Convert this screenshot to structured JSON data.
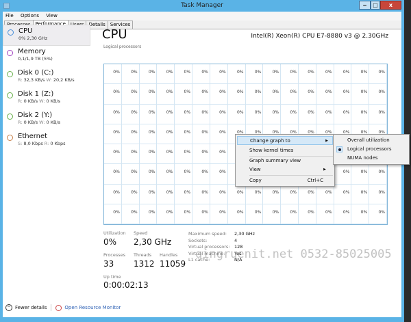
{
  "window": {
    "title": "Task Manager",
    "minimize": "‒",
    "maximize": "□",
    "close": "x"
  },
  "menu": [
    "File",
    "Options",
    "View"
  ],
  "tabs": [
    "Processes",
    "Performance",
    "Users",
    "Details",
    "Services"
  ],
  "active_tab": "Performance",
  "sidebar": [
    {
      "name": "CPU",
      "sub": "0% 2,30 GHz",
      "color": "#4a90d9",
      "selected": true
    },
    {
      "name": "Memory",
      "sub": "0,1/1,9 TB (5%)",
      "color": "#a040c0"
    },
    {
      "name": "Disk 0 (C:)",
      "sub_k1": "R:",
      "sub_v1": "32,3 KB/s",
      "sub_k2": "W:",
      "sub_v2": "20,2 KB/s",
      "color": "#6ab04c"
    },
    {
      "name": "Disk 1 (Z:)",
      "sub_k1": "R:",
      "sub_v1": "0 KB/s",
      "sub_k2": "W:",
      "sub_v2": "0 KB/s",
      "color": "#6ab04c"
    },
    {
      "name": "Disk 2 (Y:)",
      "sub_k1": "R:",
      "sub_v1": "0 KB/s",
      "sub_k2": "W:",
      "sub_v2": "0 KB/s",
      "color": "#6ab04c"
    },
    {
      "name": "Ethernet",
      "sub_k1": "S:",
      "sub_v1": "8,0 Kbps",
      "sub_k2": "R:",
      "sub_v2": "0 Kbps",
      "color": "#c8804a"
    }
  ],
  "main": {
    "title": "CPU",
    "cpu_name": "Intel(R) Xeon(R) CPU E7-8880 v3 @ 2.30GHz",
    "graph_label": "Logical processors",
    "processor_usage": [
      "0%",
      "0%",
      "0%",
      "0%",
      "0%",
      "0%",
      "0%",
      "0%",
      "0%",
      "0%",
      "0%",
      "0%",
      "0%",
      "0%",
      "0%",
      "0%",
      "0%",
      "0%",
      "0%",
      "0%",
      "0%",
      "0%",
      "0%",
      "0%",
      "0%",
      "0%",
      "0%",
      "0%",
      "0%",
      "0%",
      "0%",
      "0%",
      "0%",
      "0%",
      "0%",
      "0%",
      "0%",
      "0%",
      "0%",
      "0%",
      "0%",
      "0%",
      "0%",
      "0%",
      "0%",
      "0%",
      "0%",
      "0%",
      "0%",
      "0%",
      "0%",
      "0%",
      "0%",
      "0%",
      "0%",
      "0%",
      "0%",
      "0%",
      "0%",
      "0%",
      "0%",
      "0%",
      "0%",
      "0%",
      "0%",
      "0%",
      "0%",
      "0%",
      "0%",
      "0%",
      "0%",
      "0%",
      "0%",
      "0%",
      "0%",
      "0%",
      "0%",
      "0%",
      "0%",
      "0%",
      "0%",
      "0%",
      "0%",
      "0%",
      "0%",
      "0%",
      "0%",
      "0%",
      "0%",
      "0%",
      "0%",
      "0%",
      "0%",
      "0%",
      "0%",
      "0%",
      "0%",
      "0%",
      "0%",
      "0%",
      "0%",
      "0%",
      "0%",
      "0%",
      "0%",
      "0%",
      "0%",
      "0%",
      "0%",
      "0%",
      "0%",
      "0%",
      "0%",
      "0%",
      "0%",
      "0%",
      "0%",
      "0%",
      "0%",
      "0%",
      "0%",
      "0%",
      "0%",
      "0%",
      "0%",
      "0%",
      "0%",
      "0%"
    ]
  },
  "stats": {
    "utilization_label": "Utilization",
    "utilization": "0%",
    "speed_label": "Speed",
    "speed": "2,30 GHz",
    "processes_label": "Processes",
    "processes": "33",
    "threads_label": "Threads",
    "threads": "1312",
    "handles_label": "Handles",
    "handles": "11059",
    "uptime_label": "Up time",
    "uptime": "0:00:02:13",
    "details": [
      {
        "k": "Maximum speed:",
        "v": "2,30 GHz"
      },
      {
        "k": "Sockets:",
        "v": "4"
      },
      {
        "k": "Virtual processors:",
        "v": "128"
      },
      {
        "k": "Virtual machine:",
        "v": "Yes"
      },
      {
        "k": "L1 cache:",
        "v": "N/A"
      }
    ]
  },
  "context_menu": {
    "items": [
      "Change graph to",
      "Show kernel times",
      "Graph summary view",
      "View",
      "Copy"
    ],
    "copy_shortcut": "Ctrl+C"
  },
  "submenu": {
    "items": [
      "Overall utilization",
      "Logical processors",
      "NUMA nodes"
    ],
    "selected": "Logical processors"
  },
  "footer": {
    "fewer_details": "Fewer details",
    "open_resource_monitor": "Open Resource Monitor"
  },
  "watermark": "qingruenit.net 0532-85025005"
}
